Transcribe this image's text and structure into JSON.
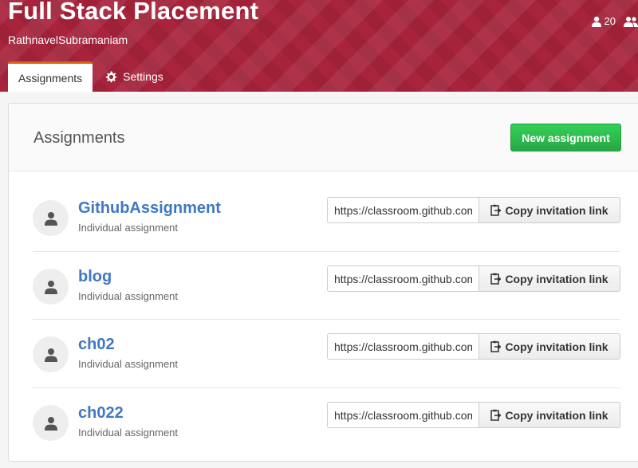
{
  "header": {
    "org_title": "Full Stack Placement",
    "org_user": "RathnavelSubramaniam",
    "students_count": "20"
  },
  "tabs": [
    {
      "label": "Assignments",
      "active": true
    },
    {
      "label": "Settings",
      "icon": "gear-icon",
      "active": false
    }
  ],
  "panel": {
    "title": "Assignments",
    "new_button_label": "New assignment"
  },
  "assignments": [
    {
      "name": "GithubAssignment",
      "type": "Individual assignment",
      "link": "https://classroom.github.com",
      "copy_label": "Copy invitation link"
    },
    {
      "name": "blog",
      "type": "Individual assignment",
      "link": "https://classroom.github.com",
      "copy_label": "Copy invitation link"
    },
    {
      "name": "ch02",
      "type": "Individual assignment",
      "link": "https://classroom.github.com",
      "copy_label": "Copy invitation link"
    },
    {
      "name": "ch022",
      "type": "Individual assignment",
      "link": "https://classroom.github.com",
      "copy_label": "Copy invitation link"
    }
  ],
  "colors": {
    "banner": "#a8233c",
    "link": "#4078c0",
    "primary_button": "#28a745"
  }
}
